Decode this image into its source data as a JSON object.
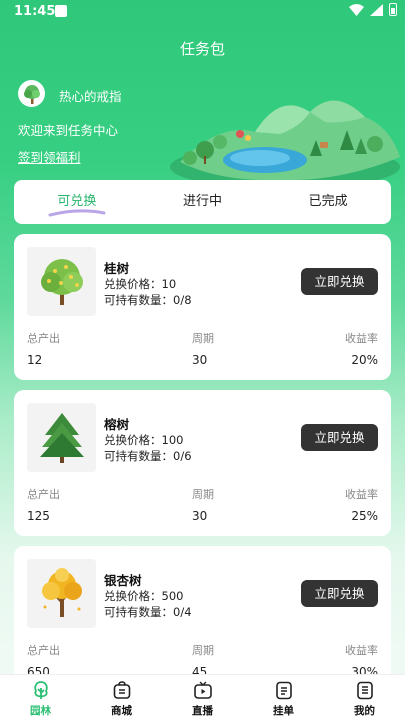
{
  "status": {
    "time": "11:45"
  },
  "header": {
    "title": "任务包"
  },
  "profile": {
    "username": "热心的戒指",
    "welcome": "欢迎来到任务中心",
    "signin": "签到领福利"
  },
  "tabs": [
    {
      "label": "可兑换",
      "active": true
    },
    {
      "label": "进行中",
      "active": false
    },
    {
      "label": "已完成",
      "active": false
    }
  ],
  "labels": {
    "price_prefix": "兑换价格：",
    "hold_prefix": "可持有数量：",
    "exchange_button": "立即兑换",
    "total_output": "总产出",
    "period": "周期",
    "yield": "收益率"
  },
  "items": [
    {
      "name": "桂树",
      "price": "兑换价格：10",
      "hold": "可持有数量：0/8",
      "total": "12",
      "period": "30",
      "yield": "20%",
      "icon": "osmanthus-tree-icon"
    },
    {
      "name": "榕树",
      "price": "兑换价格：100",
      "hold": "可持有数量：0/6",
      "total": "125",
      "period": "30",
      "yield": "25%",
      "icon": "banyan-tree-icon"
    },
    {
      "name": "银杏树",
      "price": "兑换价格：500",
      "hold": "可持有数量：0/4",
      "total": "650",
      "period": "45",
      "yield": "30%",
      "icon": "ginkgo-tree-icon"
    }
  ],
  "nav": [
    {
      "label": "园林",
      "icon": "tree-icon",
      "active": true
    },
    {
      "label": "商城",
      "icon": "shop-bag-icon",
      "active": false
    },
    {
      "label": "直播",
      "icon": "tv-play-icon",
      "active": false
    },
    {
      "label": "挂单",
      "icon": "order-list-icon",
      "active": false
    },
    {
      "label": "我的",
      "icon": "profile-doc-icon",
      "active": false
    }
  ],
  "colors": {
    "accent": "#2bbf73",
    "button": "#333333"
  }
}
